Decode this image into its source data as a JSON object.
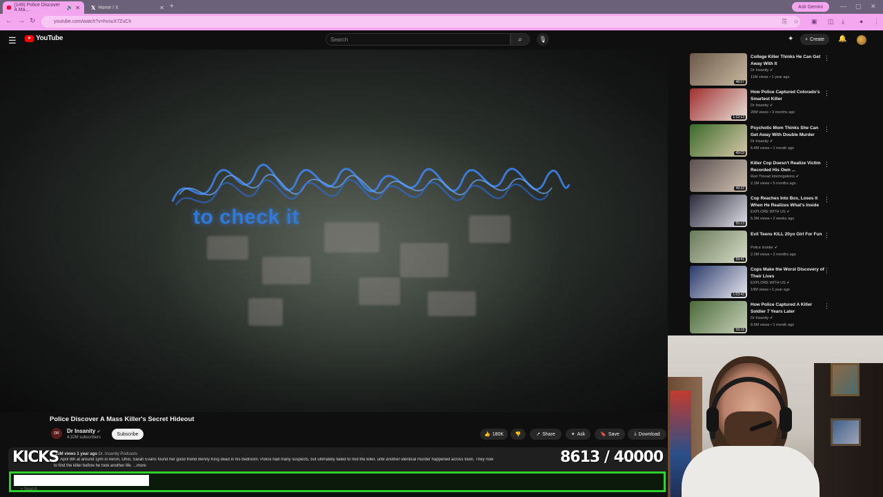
{
  "browser": {
    "tabs": [
      {
        "label": "(149) Police Discover A Ma...",
        "active": true
      },
      {
        "label": "Home / X",
        "active": false
      }
    ],
    "new_tab_icon": "plus-icon",
    "ask_gemini": "Ask Gemini",
    "url": "youtube.com/watch?v=hvsuX7ZuCh"
  },
  "youtube": {
    "logo_text": "YouTube",
    "search_placeholder": "Search",
    "create_label": "Create"
  },
  "video": {
    "overlay_text": "to check it",
    "title": "Police Discover A Mass Killer's Secret Hideout",
    "channel": "Dr Insanity",
    "channel_avatar_text": "DR",
    "subscribers": "4.32M subscribers",
    "subscribe_label": "Subscribe",
    "likes": "180K",
    "share_label": "Share",
    "ask_label": "Ask",
    "save_label": "Save",
    "download_label": "Download",
    "views_date": "16M views  1 year ago",
    "hashtag": "Dr. Insanity Podcasts",
    "description_line1": "On April 8th at around 1pm in Akron, Ohio, Sarah Evans found her good friend Benny King dead in his bedroom. Police had many suspects, but ultimately failed to find the killer, until another identical murder happened across town. They now",
    "description_line2": "to find the killer before he took another life.",
    "more_label": "...more"
  },
  "stream_overlay": {
    "kicks_label": "KICKS",
    "counter": "8613 / 40000",
    "progress_fraction": 0.2153,
    "taskbar_search": "Search"
  },
  "related": [
    {
      "title": "College Killer Thinks He Can Get Away With It",
      "channel": "Dr Insanity",
      "meta": "11M views • 1 year ago",
      "duration": "48:57",
      "thumb": [
        "#6b5a4a",
        "#c8b8a0"
      ]
    },
    {
      "title": "How Police Captured Colorado's Smartest Killer",
      "channel": "Dr Insanity",
      "meta": "20M views • 3 months ago",
      "duration": "1:12:13",
      "thumb": [
        "#a03030",
        "#e8e0d8"
      ]
    },
    {
      "title": "Psychotic Mom Thinks She Can Get Away With Double Murder",
      "channel": "Dr Insanity",
      "meta": "6.4M views • 1 month ago",
      "duration": "49:03",
      "thumb": [
        "#3a6a2a",
        "#d8c8a8"
      ]
    },
    {
      "title": "Killer Cop Doesn't Realize Victim Recorded His Own ...",
      "channel": "Red Thread Interrogations",
      "meta": "2.1M views • 5 months ago",
      "duration": "49:32",
      "thumb": [
        "#5a5050",
        "#d0c0b0"
      ]
    },
    {
      "title": "Cop Reaches Into Box, Loses It When He Realizes What's Inside",
      "channel": "EXPLORE WITH US",
      "meta": "5.3M views • 2 weeks ago",
      "duration": "55:13",
      "thumb": [
        "#2a2a3a",
        "#e0e0e8"
      ]
    },
    {
      "title": "Evil Teens KILL 20yo Girl For Fun",
      "channel": "Police Insider",
      "meta": "2.2M views • 2 months ago",
      "duration": "59:41",
      "thumb": [
        "#6a7a5a",
        "#d8dcc8"
      ]
    },
    {
      "title": "Cops Make the Worst Discovery of Their Lives",
      "channel": "EXPLORE WITH US",
      "meta": "19M views • 1 year ago",
      "duration": "1:03:43",
      "thumb": [
        "#2a3a6a",
        "#e8e8f0"
      ]
    },
    {
      "title": "How Police Captured A Killer Soldier 7 Years Later",
      "channel": "Dr Insanity",
      "meta": "8.6M views • 1 month ago",
      "duration": "59:18",
      "thumb": [
        "#4a6a3a",
        "#c8d0b8"
      ]
    }
  ],
  "colors": {
    "accent_pink": "#f4a7ee",
    "yt_red": "#ff0000",
    "progress_green": "#2ed12e"
  }
}
